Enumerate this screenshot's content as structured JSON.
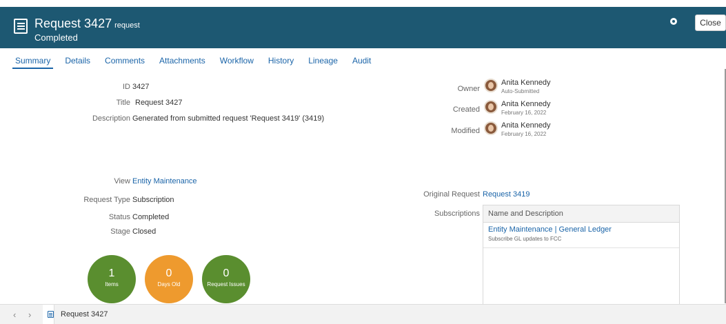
{
  "header": {
    "title": "Request 3427",
    "title_sub": "request",
    "status": "Completed",
    "close_label": "Close",
    "icon": "request-icon",
    "bg_color": "#1d5872"
  },
  "tabs": [
    {
      "label": "Summary",
      "active": true
    },
    {
      "label": "Details"
    },
    {
      "label": "Comments"
    },
    {
      "label": "Attachments"
    },
    {
      "label": "Workflow"
    },
    {
      "label": "History"
    },
    {
      "label": "Lineage"
    },
    {
      "label": "Audit"
    }
  ],
  "summary": {
    "id_label": "ID",
    "id_value": "3427",
    "title_label": "Title",
    "title_value": "Request 3427",
    "description_label": "Description",
    "description_value": "Generated from submitted request 'Request 3419' (3419)",
    "view_label": "View",
    "view_value": "Entity Maintenance",
    "request_type_label": "Request Type",
    "request_type_value": "Subscription",
    "status_label": "Status",
    "status_value": "Completed",
    "stage_label": "Stage",
    "stage_value": "Closed"
  },
  "people": {
    "owner_label": "Owner",
    "owner_name": "Anita Kennedy",
    "owner_sub": "Auto-Submitted",
    "created_label": "Created",
    "created_name": "Anita Kennedy",
    "created_sub": "February 16, 2022",
    "modified_label": "Modified",
    "modified_name": "Anita Kennedy",
    "modified_sub": "February 16, 2022"
  },
  "right": {
    "original_request_label": "Original Request",
    "original_request_value": "Request 3419",
    "subscriptions_label": "Subscriptions"
  },
  "subscriptions_table": {
    "header": "Name and Description",
    "rows": [
      {
        "name": "Entity Maintenance | General Ledger",
        "description": "Subscribe GL updates to FCC"
      }
    ]
  },
  "stats": [
    {
      "value": "1",
      "label": "Items",
      "color": "#5a8e2f"
    },
    {
      "value": "0",
      "label": "Days Old",
      "color": "#ee9a2e"
    },
    {
      "value": "0",
      "label": "Request Issues",
      "color": "#5a8e2f"
    }
  ],
  "footer": {
    "tab_label": "Request 3427"
  }
}
